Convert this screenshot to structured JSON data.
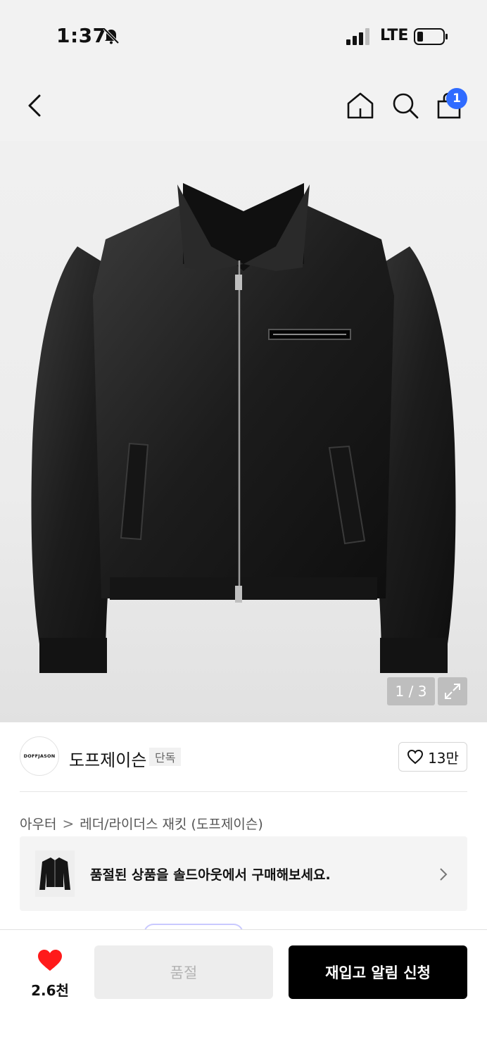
{
  "status_bar": {
    "time": "1:37",
    "network": "LTE"
  },
  "header": {
    "cart_count": "1"
  },
  "gallery": {
    "counter": "1 / 3"
  },
  "brand": {
    "logo_text": "DOFFJASON",
    "name": "도프제이슨",
    "badge": "단독",
    "likes": "13만"
  },
  "breadcrumb": {
    "level1": "아우터",
    "separator": ">",
    "level2": "레더/라이더스 재킷 (도프제이슨)"
  },
  "soldout_banner": {
    "text": "품절된 상품을 솔드아웃에서 구매해보세요."
  },
  "bottom_bar": {
    "wish_count": "2.6천",
    "soldout_label": "품절",
    "restock_label": "재입고 알림 신청"
  },
  "colors": {
    "badge_blue": "#2f6bff",
    "heart_red": "#ff1a1a",
    "button_black": "#000000"
  }
}
